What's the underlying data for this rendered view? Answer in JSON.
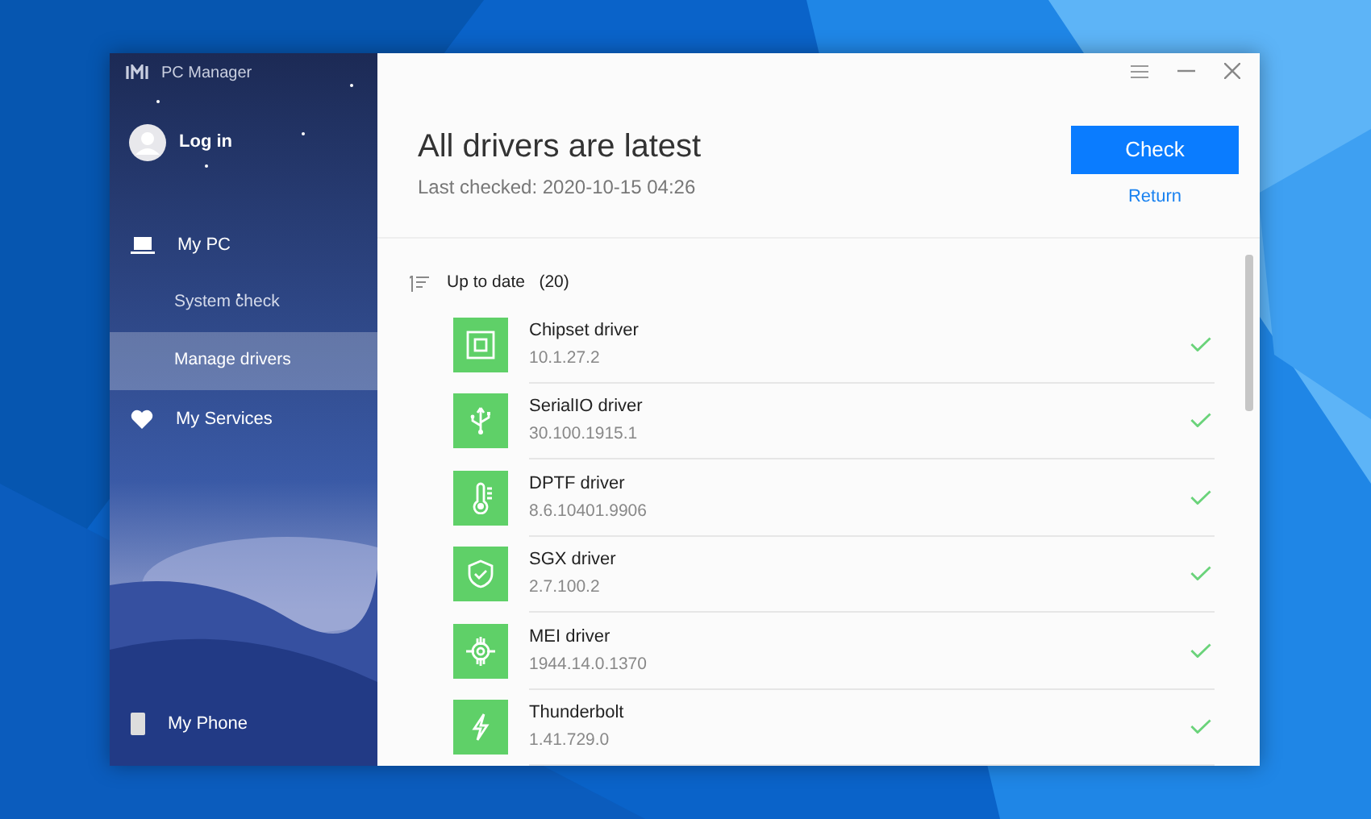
{
  "app": {
    "title": "PC Manager"
  },
  "account": {
    "label": "Log in"
  },
  "nav": [
    {
      "label": "My PC",
      "selected": false,
      "children": [
        {
          "label": "System check",
          "selected": false
        },
        {
          "label": "Manage drivers",
          "selected": true
        }
      ]
    },
    {
      "label": "My Services",
      "selected": false
    }
  ],
  "footer_nav": {
    "label": "My Phone",
    "selected": false
  },
  "header": {
    "title": "All drivers are latest",
    "subtitle": "Last checked: 2020-10-15 04:26",
    "check_button": "Check",
    "return_link": "Return"
  },
  "group": {
    "label": "Up to date",
    "count": "(20)"
  },
  "drivers": [
    {
      "name": "Chipset driver",
      "version": "10.1.27.2",
      "up_to_date": true
    },
    {
      "name": "SerialIO driver",
      "version": "30.100.1915.1",
      "up_to_date": true
    },
    {
      "name": "DPTF driver",
      "version": "8.6.10401.9906",
      "up_to_date": true
    },
    {
      "name": "SGX driver",
      "version": "2.7.100.2",
      "up_to_date": true
    },
    {
      "name": "MEI driver",
      "version": "1944.14.0.1370",
      "up_to_date": true
    },
    {
      "name": "Thunderbolt",
      "version": "1.41.729.0",
      "up_to_date": true
    }
  ]
}
